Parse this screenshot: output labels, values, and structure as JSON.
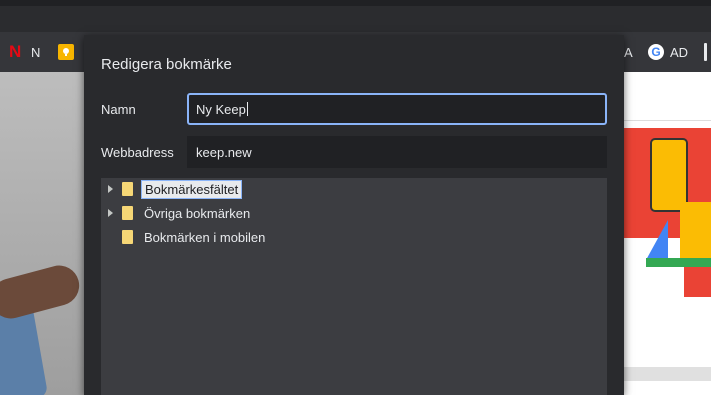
{
  "browser": {
    "bookmarks_bar": {
      "items": [
        {
          "icon": "netflix-icon",
          "label": "N"
        },
        {
          "icon": "google-keep-icon",
          "label": ""
        },
        {
          "icon": "",
          "label": "A"
        },
        {
          "icon": "google-icon",
          "label": "AD"
        }
      ]
    }
  },
  "dialog": {
    "title": "Redigera bokmärke",
    "name_label": "Namn",
    "name_value": "Ny Keep",
    "url_label": "Webbadress",
    "url_value": "keep.new",
    "folders": [
      {
        "label": "Bokmärkesfältet",
        "expandable": true,
        "selected": true
      },
      {
        "label": "Övriga bokmärken",
        "expandable": true,
        "selected": false
      },
      {
        "label": "Bokmärken i mobilen",
        "expandable": false,
        "selected": false
      }
    ]
  },
  "colors": {
    "dialog_bg": "#292a2d",
    "field_bg": "#202124",
    "focus_ring": "#8ab4f8",
    "folder": "#f6d776",
    "netflix_red": "#e50914",
    "keep_yellow": "#f7b500"
  }
}
